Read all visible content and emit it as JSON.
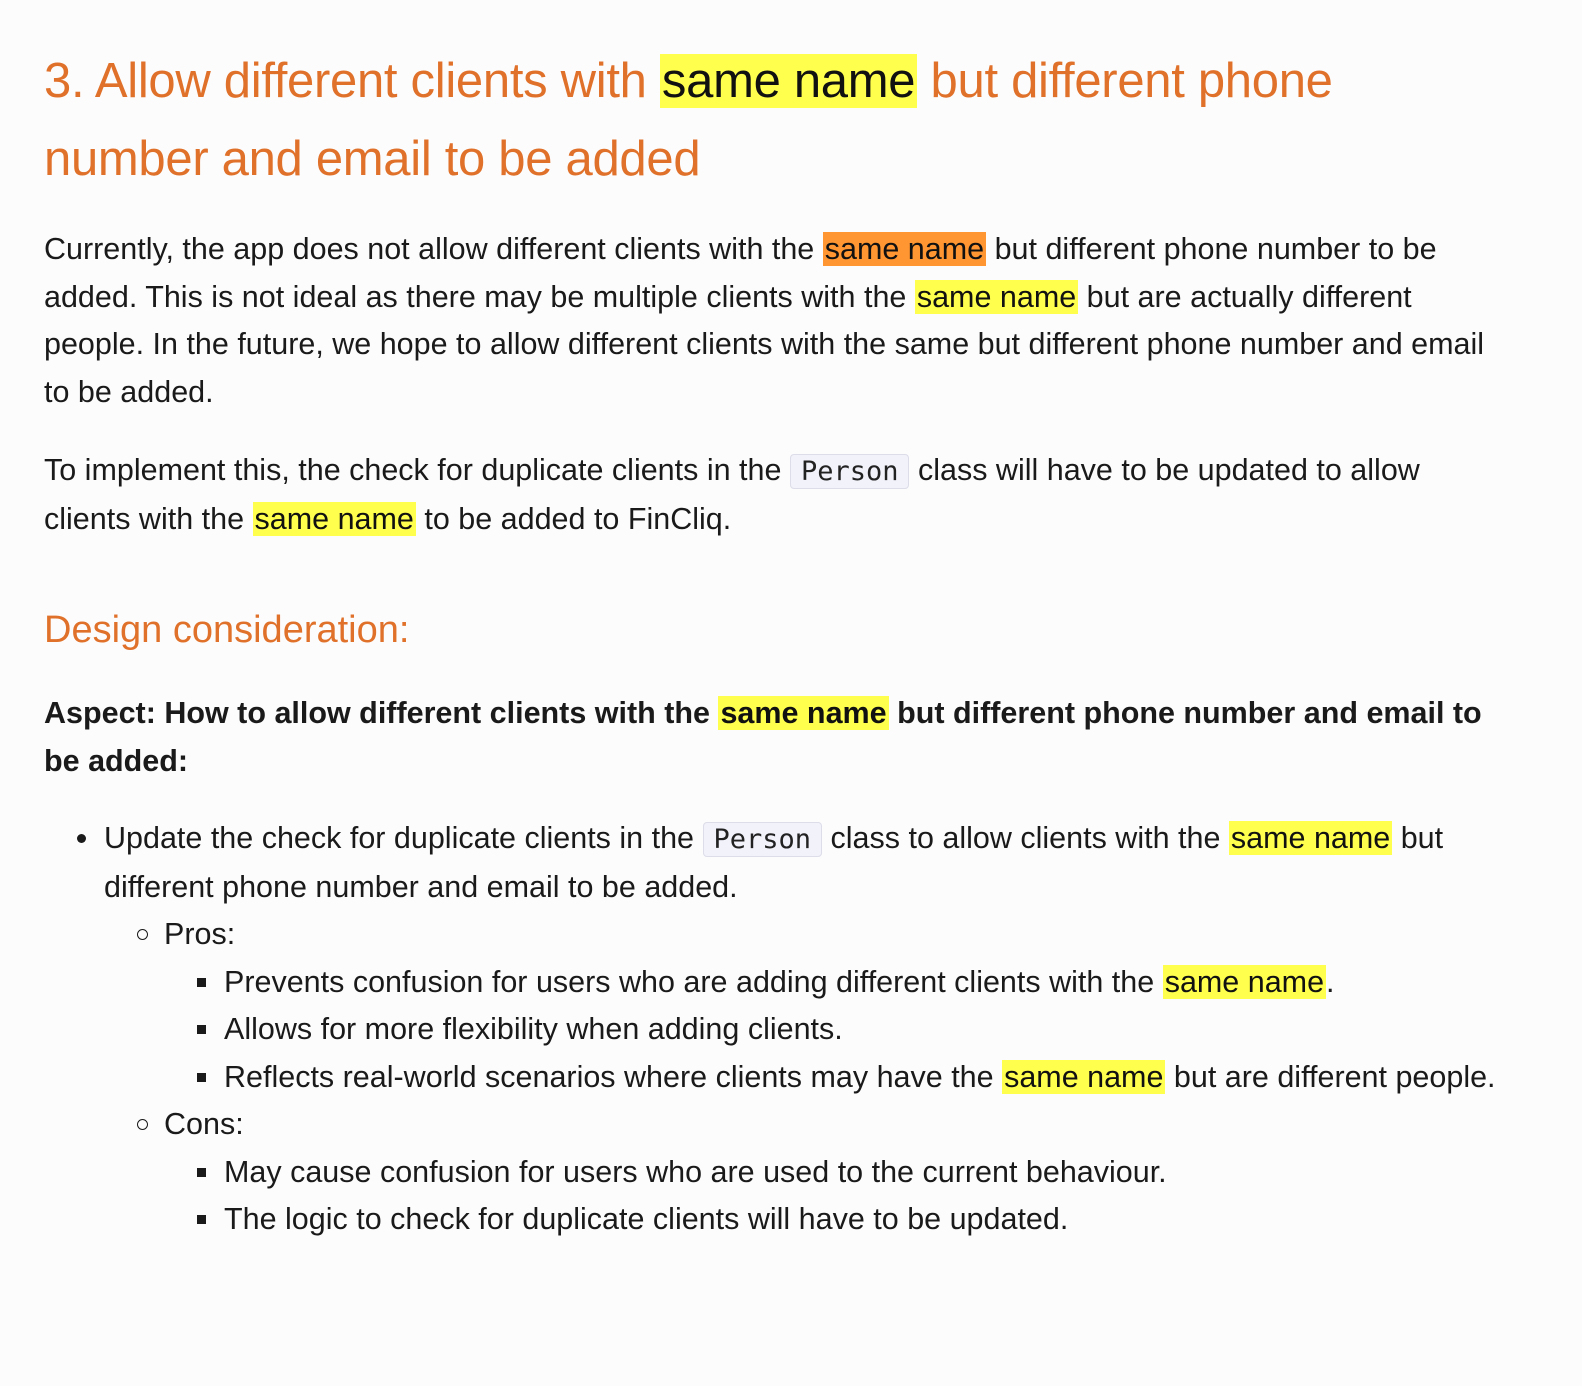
{
  "heading": {
    "before": "3. Allow different clients with ",
    "highlight": "same name",
    "after": " but different phone number and email to be added"
  },
  "para1": {
    "s1": "Currently, the app does not allow different clients with the ",
    "h1": "same name",
    "s2": " but different phone number to be added. This is not ideal as there may be multiple clients with the ",
    "h2": "same name",
    "s3": " but are actually different people. In the future, we hope to allow different clients with the same but different phone number and email to be added."
  },
  "para2": {
    "s1": "To implement this, the check for duplicate clients in the ",
    "code": "Person",
    "s2": " class will have to be updated to allow clients with the ",
    "h1": "same name",
    "s3": " to be added to FinCliq."
  },
  "subheading": "Design consideration:",
  "aspect": {
    "s1": "Aspect: How to allow different clients with the ",
    "h1": "same name",
    "s2": " but different phone number and email to be added:"
  },
  "option": {
    "s1": "Update the check for duplicate clients in the ",
    "code": "Person",
    "s2": " class to allow clients with the ",
    "h1": "same name",
    "s3": " but different phone number and email to be added."
  },
  "pros": {
    "label": "Pros:",
    "item1": {
      "s1": "Prevents confusion for users who are adding different clients with the ",
      "h1": "same name",
      "s2": "."
    },
    "item2": "Allows for more flexibility when adding clients.",
    "item3": {
      "s1": "Reflects real-world scenarios where clients may have the ",
      "h1": "same name",
      "s2": " but are different people."
    }
  },
  "cons": {
    "label": "Cons:",
    "item1": "May cause confusion for users who are used to the current behaviour.",
    "item2": "The logic to check for duplicate clients will have to be updated."
  },
  "colors": {
    "heading": "#e0712a",
    "highlight": "#ffff4d",
    "current_match": "#ff9632"
  }
}
